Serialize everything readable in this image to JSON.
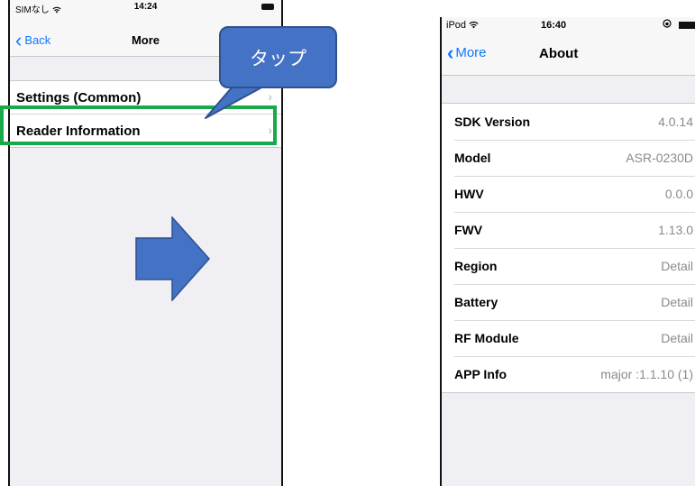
{
  "left_screen": {
    "status": {
      "carrier": "SIMなし",
      "time": "14:24"
    },
    "nav": {
      "back_label": "Back",
      "title": "More"
    },
    "menu_items": [
      {
        "label": "Settings (Common)"
      },
      {
        "label": "Reader Information"
      }
    ],
    "callout_text": "タップ",
    "highlight_color": "#19a84a"
  },
  "right_screen": {
    "status": {
      "carrier": "iPod",
      "time": "16:40"
    },
    "nav": {
      "back_label": "More",
      "title": "About"
    },
    "rows": [
      {
        "label": "SDK Version",
        "value": "4.0.14"
      },
      {
        "label": "Model",
        "value": "ASR-0230D"
      },
      {
        "label": "HWV",
        "value": "0.0.0"
      },
      {
        "label": "FWV",
        "value": "1.13.0"
      },
      {
        "label": "Region",
        "value": "Detail"
      },
      {
        "label": "Battery",
        "value": "Detail"
      },
      {
        "label": "RF Module",
        "value": "Detail"
      },
      {
        "label": "APP Info",
        "value": "major :1.1.10 (1)"
      }
    ]
  },
  "colors": {
    "accent": "#0a7aff",
    "callout": "#4472c4",
    "arrow": "#4472c4"
  }
}
